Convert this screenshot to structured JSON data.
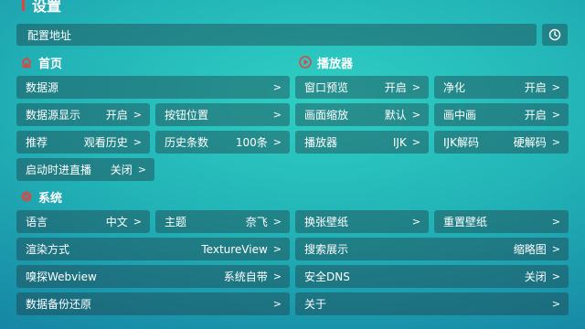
{
  "title": "设置",
  "config": {
    "label": "配置地址",
    "history_icon": "history-icon"
  },
  "sections": {
    "home": {
      "label": "首页",
      "icon": "home-icon",
      "color": "#e8413a"
    },
    "player": {
      "label": "播放器",
      "icon": "play-circle-icon",
      "color": "#e8413a"
    },
    "system": {
      "label": "系统",
      "icon": "gear-icon",
      "color": "#e8413a"
    }
  },
  "arrow": ">",
  "home": {
    "datasource": {
      "label": "数据源"
    },
    "datasource_display": {
      "label": "数据源显示",
      "value": "开启"
    },
    "button_position": {
      "label": "按钮位置"
    },
    "recommend": {
      "label": "推荐",
      "value": "观看历史"
    },
    "history_count": {
      "label": "历史条数",
      "value": "100条"
    },
    "startup_live": {
      "label": "启动时进直播",
      "value": "关闭"
    }
  },
  "player": {
    "window_preview": {
      "label": "窗口预览",
      "value": "开启"
    },
    "purify": {
      "label": "净化",
      "value": "开启"
    },
    "scale": {
      "label": "画面缩放",
      "value": "默认"
    },
    "pip": {
      "label": "画中画",
      "value": "开启"
    },
    "player": {
      "label": "播放器",
      "value": "IJK"
    },
    "ijk_decode": {
      "label": "IJK解码",
      "value": "硬解码"
    }
  },
  "system": {
    "language": {
      "label": "语言",
      "value": "中文"
    },
    "theme": {
      "label": "主题",
      "value": "奈飞"
    },
    "change_wallpaper": {
      "label": "换张壁纸"
    },
    "reset_wallpaper": {
      "label": "重置壁纸"
    },
    "render_mode": {
      "label": "渲染方式",
      "value": "TextureView"
    },
    "search_display": {
      "label": "搜索展示",
      "value": "缩略图"
    },
    "sniff_webview": {
      "label": "嗅探Webview",
      "value": "系统自带"
    },
    "secure_dns": {
      "label": "安全DNS",
      "value": "关闭"
    },
    "backup_restore": {
      "label": "数据备份还原"
    },
    "about": {
      "label": "关于"
    }
  }
}
